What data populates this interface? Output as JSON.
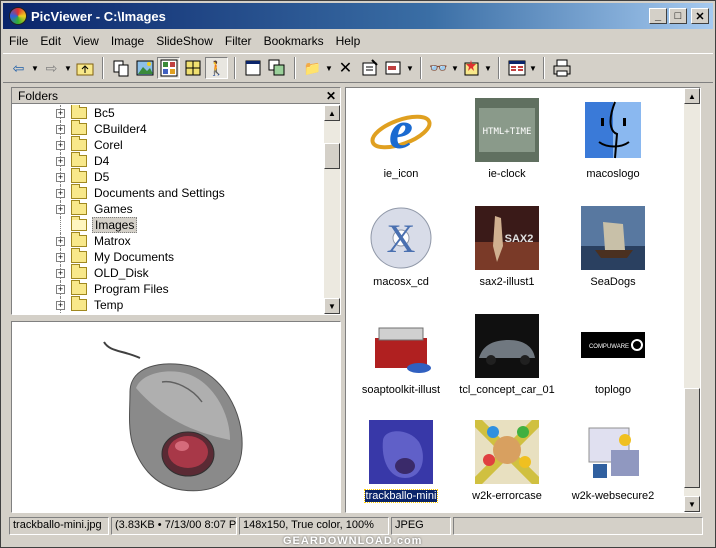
{
  "window": {
    "title": "PicViewer - C:\\Images",
    "controls": {
      "minimize": "_",
      "maximize": "□",
      "close": "✕"
    }
  },
  "menu": [
    "File",
    "Edit",
    "View",
    "Image",
    "SlideShow",
    "Filter",
    "Bookmarks",
    "Help"
  ],
  "toolbar_icons": [
    "back-arrow-icon",
    "forward-arrow-icon",
    "up-folder-icon",
    "copy-icon",
    "image-view-icon",
    "thumbnail-view-icon",
    "grid-view-icon",
    "walk-icon",
    "fullscreen-icon",
    "slideshow-icon",
    "move-icon",
    "delete-icon",
    "properties-icon",
    "rename-icon",
    "glasses-icon",
    "effects-icon",
    "layout-icon",
    "print-icon"
  ],
  "folders_panel": {
    "header": "Folders",
    "close": "✕",
    "items": [
      {
        "label": "Bc5",
        "expand": "+"
      },
      {
        "label": "CBuilder4",
        "expand": "+"
      },
      {
        "label": "Corel",
        "expand": "+"
      },
      {
        "label": "D4",
        "expand": "+"
      },
      {
        "label": "D5",
        "expand": "+"
      },
      {
        "label": "Documents and Settings",
        "expand": "+"
      },
      {
        "label": "Games",
        "expand": "+"
      },
      {
        "label": "Images",
        "expand": "",
        "selected": true
      },
      {
        "label": "Matrox",
        "expand": "+"
      },
      {
        "label": "My Documents",
        "expand": "+"
      },
      {
        "label": "OLD_Disk",
        "expand": "+"
      },
      {
        "label": "Program Files",
        "expand": "+"
      },
      {
        "label": "Temp",
        "expand": "+"
      }
    ]
  },
  "thumbnails": [
    {
      "label": "ie_icon",
      "kind": "ie-logo"
    },
    {
      "label": "ie-clock",
      "kind": "html-time"
    },
    {
      "label": "macoslogo",
      "kind": "mac-face"
    },
    {
      "label": "macosx_cd",
      "kind": "osx-cd"
    },
    {
      "label": "sax2-illust1",
      "kind": "sax2"
    },
    {
      "label": "SeaDogs",
      "kind": "seadogs"
    },
    {
      "label": "soaptoolkit-illust",
      "kind": "toolbox"
    },
    {
      "label": "tcl_concept_car_01",
      "kind": "car"
    },
    {
      "label": "toplogo",
      "kind": "compuware"
    },
    {
      "label": "trackballo-mini",
      "kind": "trackball-mini",
      "selected": true
    },
    {
      "label": "w2k-errorcase",
      "kind": "errorcase"
    },
    {
      "label": "w2k-websecure2",
      "kind": "websecure"
    }
  ],
  "thumb_text": {
    "html_time": "HTML+TIME",
    "sax2": "SAX2",
    "compuware": "COMPUWARE"
  },
  "status": {
    "filename": "trackballo-mini.jpg",
    "size_date": "(3.83KB • 7/13/00 8:07 P",
    "dimensions": "148x150, True color, 100%",
    "format": "JPEG",
    "extra": ""
  },
  "watermark": "GEARDOWNLOAD.com"
}
